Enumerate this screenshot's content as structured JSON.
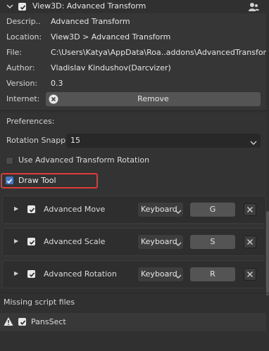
{
  "addon": {
    "title": "View3D: Advanced Transform",
    "enabled": true,
    "description_label": "Descrip..",
    "description_value": "Advanced Transform",
    "location_label": "Location:",
    "location_value": "View3D > Advanced Transform",
    "file_label": "File:",
    "file_value": "C:\\Users\\Katya\\AppData\\Roa..addons\\AdvancedTransform.p",
    "author_label": "Author:",
    "author_value": "Vladislav Kindushov(Darcvizer)",
    "version_label": "Version:",
    "version_value": "0.3",
    "internet_label": "Internet:",
    "remove_label": "Remove"
  },
  "preferences": {
    "title": "Preferences:",
    "rotation_snap_label": "Rotation Snapp..",
    "rotation_snap_value": "15",
    "use_advanced_rotation_label": "Use Advanced Transform Rotation",
    "use_advanced_rotation": false,
    "draw_tool_label": "Draw Tool",
    "draw_tool": true,
    "highlight_color": "#e03a3a"
  },
  "keymaps": [
    {
      "name": "Advanced Move",
      "enabled": true,
      "type": "Keyboard",
      "key": "G"
    },
    {
      "name": "Advanced Scale",
      "enabled": true,
      "type": "Keyboard",
      "key": "S"
    },
    {
      "name": "Advanced Rotation",
      "enabled": true,
      "type": "Keyboard",
      "key": "R"
    }
  ],
  "missing": {
    "title": "Missing script files",
    "items": [
      {
        "name": "PansSect",
        "enabled": true
      }
    ]
  },
  "icons": [
    "chevron-down-icon",
    "user-icon",
    "remove-x-icon",
    "expand-arrow-icon",
    "close-icon",
    "warning-icon"
  ]
}
